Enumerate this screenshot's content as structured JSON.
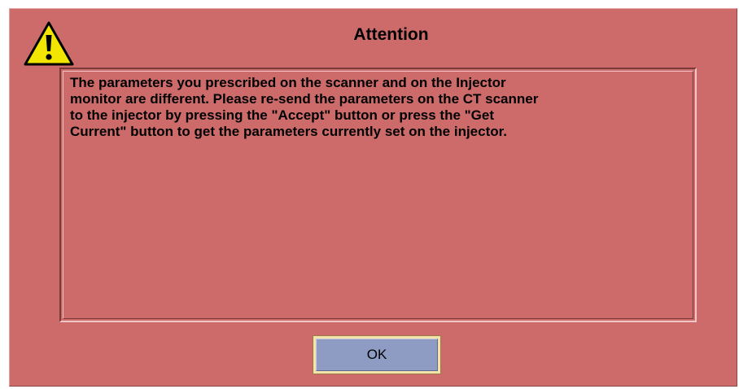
{
  "dialog": {
    "title": "Attention",
    "icon": "warning-icon",
    "message": "The parameters you prescribed on the scanner and on the Injector\nmonitor are different. Please re-send the parameters on the CT scanner\nto the injector by pressing the \"Accept\" button or press the \"Get\nCurrent\" button to get the parameters currently set on the injector.",
    "ok_label": "OK"
  },
  "colors": {
    "dialog_background": "#cd6b6b",
    "button_background": "#8e9cc4",
    "warning_fill": "#f2e600"
  }
}
